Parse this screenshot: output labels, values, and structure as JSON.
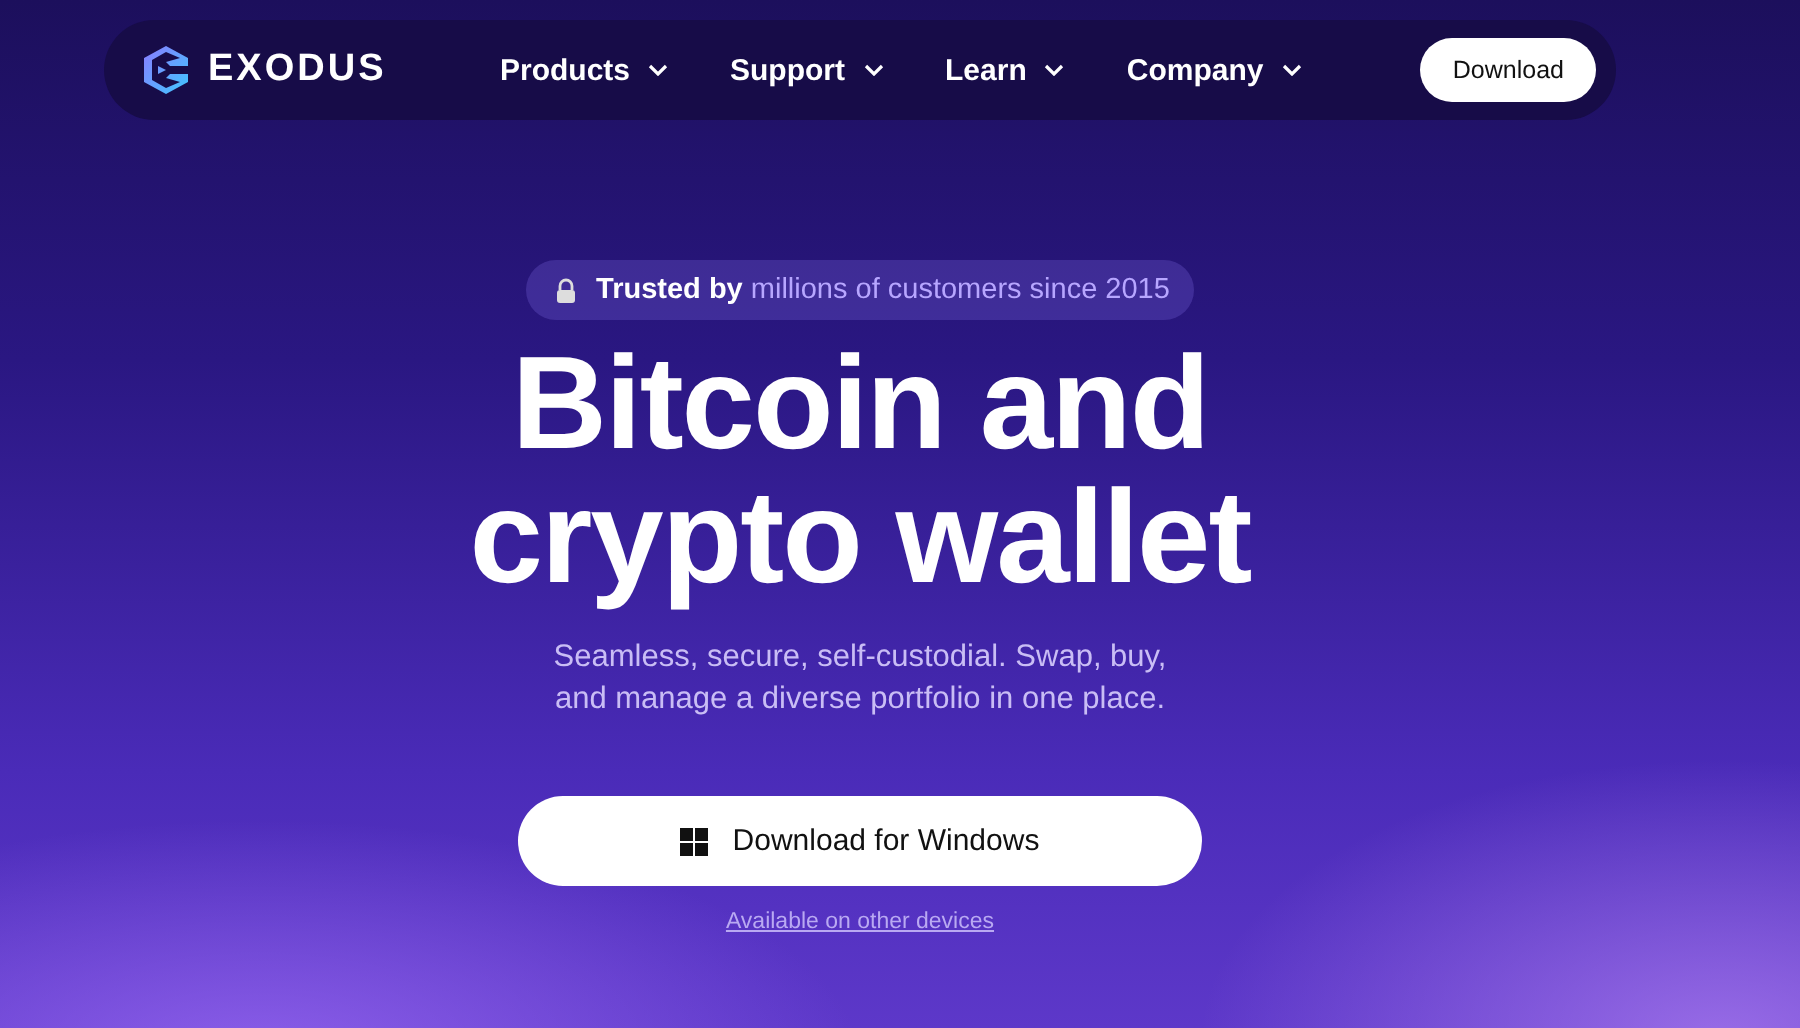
{
  "nav": {
    "logo": "EXODUS",
    "menu": [
      {
        "label": "Products"
      },
      {
        "label": "Support"
      },
      {
        "label": "Learn"
      },
      {
        "label": "Company"
      }
    ],
    "cta": "Download"
  },
  "hero": {
    "badge": "**Trusted by** millions of customers since 2015",
    "title_lines": [
      "Bitcoin and",
      "crypto wallet"
    ],
    "subtitle_lines": [
      "Seamless, secure, self-custodial. Swap, buy,",
      "and manage a diverse portfolio in one place."
    ],
    "button": "Download for Windows",
    "link": "Available on other devices"
  }
}
